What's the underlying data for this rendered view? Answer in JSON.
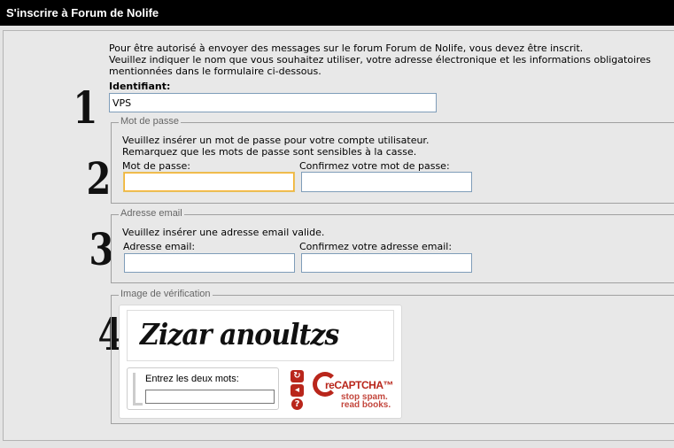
{
  "title": "S'inscrire à Forum de Nolife",
  "intro": [
    "Pour être autorisé à envoyer des messages sur le forum Forum de Nolife, vous devez être inscrit.",
    "Veuillez indiquer le nom que vous souhaitez utiliser, votre adresse électronique et les informations obligatoires",
    "mentionnées dans le formulaire ci-dessous."
  ],
  "steps": [
    "1",
    "2",
    "3",
    "4"
  ],
  "username": {
    "label": "Identifiant:",
    "value": "VPS"
  },
  "password": {
    "legend": "Mot de passe",
    "info": [
      "Veuillez insérer un mot de passe pour votre compte utilisateur.",
      "Remarquez que les mots de passe sont sensibles à la casse."
    ],
    "label": "Mot de passe:",
    "confirm_label": "Confirmez votre mot de passe:"
  },
  "email": {
    "legend": "Adresse email",
    "info": "Veuillez insérer une adresse email valide.",
    "label": "Adresse email:",
    "confirm_label": "Confirmez votre adresse email:"
  },
  "captcha": {
    "legend": "Image de vérification",
    "words": "Zizar anoultzs",
    "prompt": "Entrez les deux mots:",
    "buttons": [
      {
        "icon": "refresh-icon",
        "glyph": "↻"
      },
      {
        "icon": "audio-icon",
        "glyph": "◂"
      },
      {
        "icon": "help-icon",
        "glyph": "?"
      }
    ],
    "brand": "reCAPTCHA™",
    "tagline": [
      "stop spam.",
      "read books."
    ]
  },
  "colors": {
    "titlebar": "#000000",
    "recaptcha_red": "#b9261b",
    "focus_border": "#e5c365"
  }
}
